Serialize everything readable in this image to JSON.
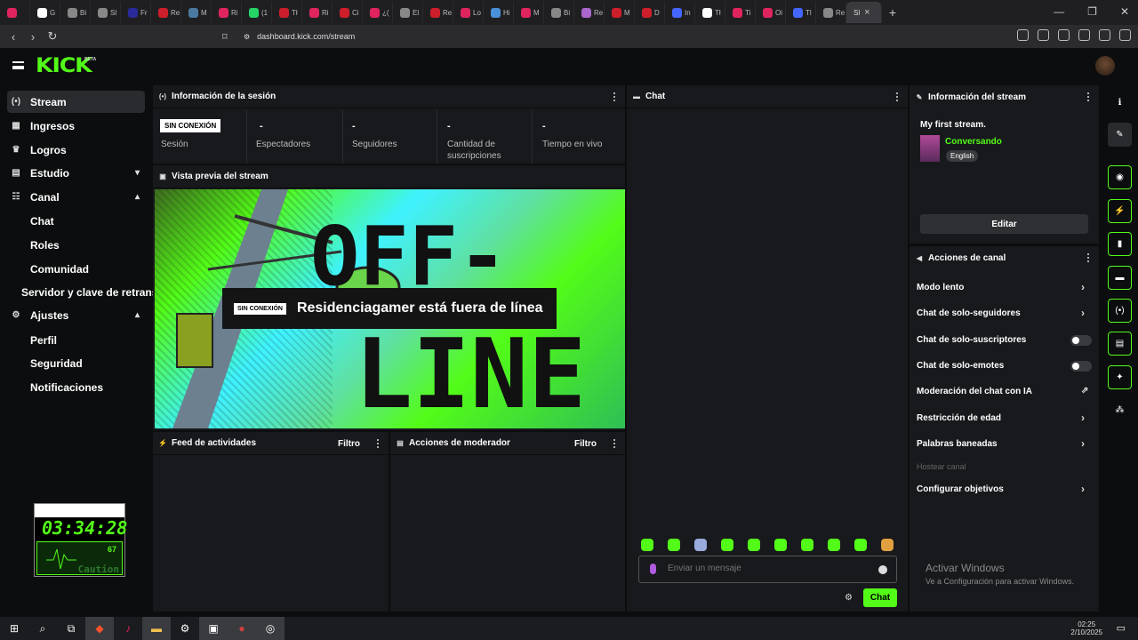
{
  "browser": {
    "tabs": [
      {
        "label": "",
        "color": "#e0245e"
      },
      {
        "label": "G",
        "color": "#ffffff"
      },
      {
        "label": "Bi",
        "color": "#888888"
      },
      {
        "label": "Sl",
        "color": "#888888"
      },
      {
        "label": "Fr",
        "color": "#2a2a9a"
      },
      {
        "label": "Re",
        "color": "#cc1f2b"
      },
      {
        "label": "M",
        "color": "#4a7aa0"
      },
      {
        "label": "Ri",
        "color": "#e0245e"
      },
      {
        "label": "(1",
        "color": "#25d366"
      },
      {
        "label": "Tł",
        "color": "#cc1f2b"
      },
      {
        "label": "Ri",
        "color": "#e0245e"
      },
      {
        "label": "Ci",
        "color": "#cc1f2b"
      },
      {
        "label": "¿(",
        "color": "#e0245e"
      },
      {
        "label": "El",
        "color": "#888888"
      },
      {
        "label": "Re",
        "color": "#cc1f2b"
      },
      {
        "label": "Lo",
        "color": "#e0245e"
      },
      {
        "label": "Hi",
        "color": "#4a90d9"
      },
      {
        "label": "M",
        "color": "#e0245e"
      },
      {
        "label": "Bi",
        "color": "#888888"
      },
      {
        "label": "Re",
        "color": "#aa66cc"
      },
      {
        "label": "M",
        "color": "#cc1f2b"
      },
      {
        "label": "D",
        "color": "#cc1f2b"
      },
      {
        "label": "In",
        "color": "#4466ff"
      },
      {
        "label": "Tł",
        "color": "#ffffff"
      },
      {
        "label": "Ti",
        "color": "#e0245e"
      },
      {
        "label": "Oi",
        "color": "#e0245e"
      },
      {
        "label": "Tl",
        "color": "#4466ff"
      },
      {
        "label": "Re",
        "color": "#888888"
      }
    ],
    "active_tab": "Sl",
    "url": "dashboard.kick.com/stream"
  },
  "header": {
    "logo": "KICK",
    "badge": "BETA"
  },
  "sidebar": {
    "items": [
      {
        "label": "Stream",
        "icon": "(•)"
      },
      {
        "label": "Ingresos",
        "icon": "▦"
      },
      {
        "label": "Logros",
        "icon": "♛"
      },
      {
        "label": "Estudio",
        "icon": "▤",
        "chevron": "▾"
      },
      {
        "label": "Canal",
        "icon": "☷",
        "chevron": "▴"
      },
      {
        "label": "Ajustes",
        "icon": "⚙",
        "chevron": "▴"
      }
    ],
    "canal_sub": [
      "Chat",
      "Roles",
      "Comunidad",
      "Servidor y clave de retrans"
    ],
    "ajustes_sub": [
      "Perfil",
      "Seguridad",
      "Notificaciones"
    ]
  },
  "session": {
    "title": "Información de la sesión",
    "badge": "SIN CONEXIÓN",
    "stats": [
      {
        "value": "",
        "label": "Sesión"
      },
      {
        "value": "-",
        "label": "Espectadores"
      },
      {
        "value": "-",
        "label": "Seguidores"
      },
      {
        "value": "-",
        "label": "Cantidad de suscripciones"
      },
      {
        "value": "-",
        "label": "Tiempo en vivo"
      }
    ]
  },
  "preview": {
    "title": "Vista previa del stream",
    "big_top": "OFF-",
    "big_bottom": "LINE",
    "tag": "SIN CONEXIÓN",
    "message": "Residenciagamer está fuera de línea"
  },
  "activity": {
    "title": "Feed de actividades",
    "filter": "Filtro"
  },
  "moderator": {
    "title": "Acciones de moderador",
    "filter": "Filtro"
  },
  "chat": {
    "title": "Chat",
    "placeholder": "Enviar un mensaje",
    "send": "Chat",
    "emote_colors": [
      "#53fc18",
      "#53fc18",
      "#9ad",
      "#53fc18",
      "#53fc18",
      "#53fc18",
      "#53fc18",
      "#53fc18",
      "#53fc18",
      "#e0a040"
    ]
  },
  "stream_info": {
    "title": "Información del stream",
    "stream_title": "My first stream.",
    "category": "Conversando",
    "language": "English",
    "edit": "Editar"
  },
  "channel_actions": {
    "title": "Acciones de canal",
    "items": [
      {
        "label": "Modo lento",
        "control": "chevron"
      },
      {
        "label": "Chat de solo-seguidores",
        "control": "chevron"
      },
      {
        "label": "Chat de solo-suscriptores",
        "control": "toggle",
        "enabled": false
      },
      {
        "label": "Chat de solo-emotes",
        "control": "toggle",
        "enabled": false
      },
      {
        "label": "Moderación del chat con IA",
        "control": "external"
      },
      {
        "label": "Restricción de edad",
        "control": "chevron"
      },
      {
        "label": "Palabras baneadas",
        "control": "chevron"
      },
      {
        "label": "Hostear canal",
        "control": "none"
      },
      {
        "label": "Configurar objetivos",
        "control": "chevron"
      }
    ]
  },
  "widget": {
    "time": "03:34:28",
    "value": "67",
    "caution": "Caution"
  },
  "windows": {
    "watermark_title": "Activar Windows",
    "watermark_sub": "Ve a Configuración para activar Windows.",
    "time": "02:25",
    "date": "2/10/2025"
  }
}
